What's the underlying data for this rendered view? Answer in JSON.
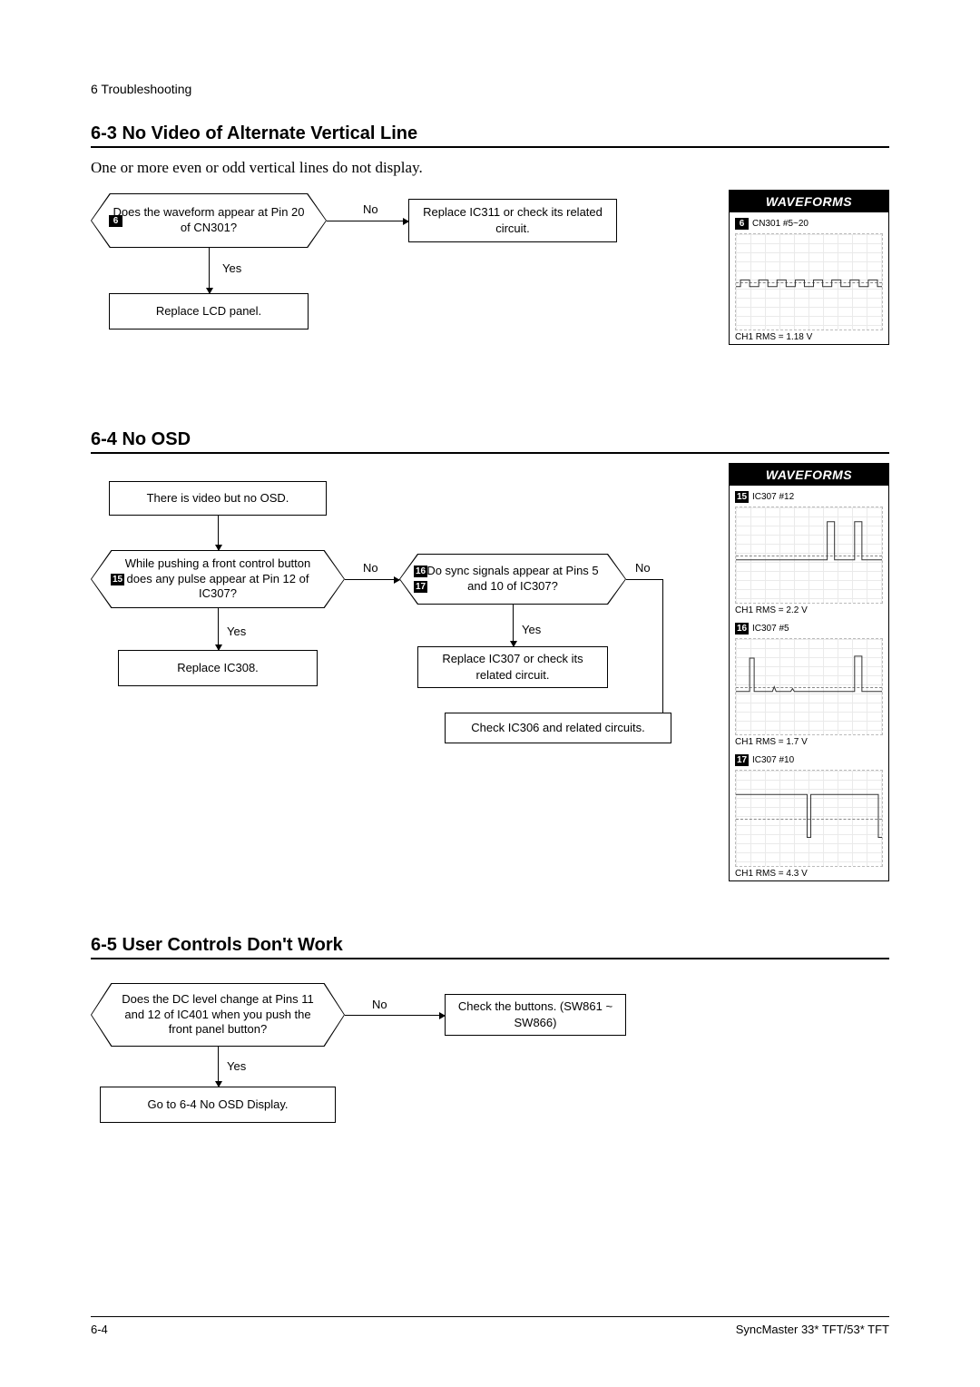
{
  "chapter": "6 Troubleshooting",
  "s63": {
    "title": "6-3 No Video of Alternate Vertical Line",
    "intro": "One or more even or odd vertical lines do not display.",
    "decision_badge": "6",
    "decision": "Does the waveform appear at Pin 20 of CN301?",
    "no": "No",
    "yes": "Yes",
    "action_no": "Replace IC311 or check its related circuit.",
    "action_yes": "Replace LCD panel.",
    "wave_label": "CN301 #5~20",
    "wave_badge": "6",
    "wave_footer": "CH1 RMS = 1.18 V"
  },
  "s64": {
    "title": "6-4 No OSD",
    "start": "There is video but no OSD.",
    "dec1_badge": "15",
    "dec1": "While pushing a front control button does any pulse appear at Pin 12 of IC307?",
    "dec2_badge1": "16",
    "dec2_badge2": "17",
    "dec2": "Do sync signals appear at Pins 5 and 10 of IC307?",
    "no": "No",
    "yes": "Yes",
    "a1": "Replace IC308.",
    "a2": "Replace IC307 or check its related circuit.",
    "a3": "Check IC306 and related circuits.",
    "waves": [
      {
        "badge": "15",
        "label": "IC307 #12",
        "footer": "CH1 RMS = 2.2 V"
      },
      {
        "badge": "16",
        "label": "IC307 #5",
        "footer": "CH1 RMS = 1.7 V"
      },
      {
        "badge": "17",
        "label": "IC307 #10",
        "footer": "CH1 RMS = 4.3 V"
      }
    ]
  },
  "s65": {
    "title": "6-5 User Controls Don't Work",
    "decision": "Does the DC level change at Pins 11 and 12 of IC401 when you push the front panel button?",
    "no": "No",
    "yes": "Yes",
    "action_no": "Check the buttons. (SW861 ~ SW866)",
    "action_yes": "Go to 6-4 No OSD Display."
  },
  "waveforms_title": "WAVEFORMS",
  "footer_left": "6-4",
  "footer_right": "SyncMaster 33* TFT/53* TFT"
}
